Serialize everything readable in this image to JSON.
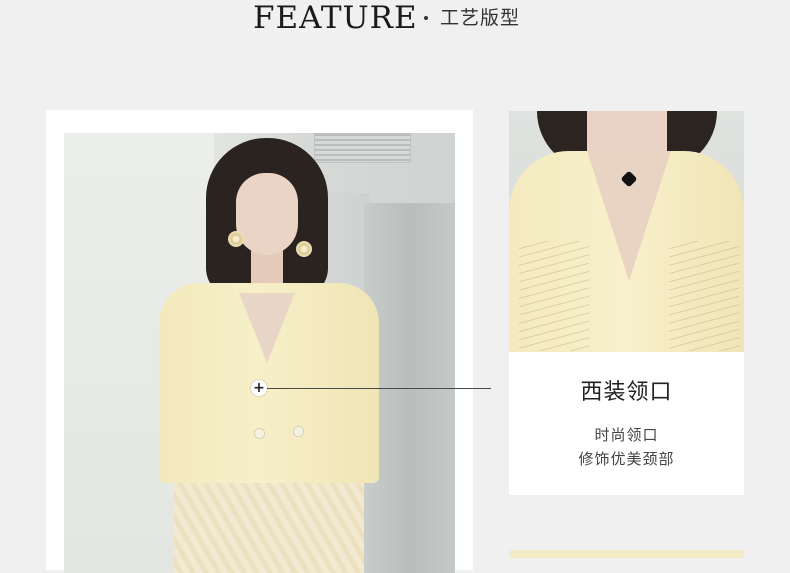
{
  "header": {
    "feature_word": "FEATURE",
    "subtitle": "工艺版型"
  },
  "callout": {
    "title": "西装领口",
    "desc_line1": "时尚领口",
    "desc_line2": "修饰优美颈部",
    "marker_symbol": "+"
  },
  "colors": {
    "background": "#f0f0f0",
    "card": "#ffffff",
    "jacket": "#f5edc5"
  }
}
